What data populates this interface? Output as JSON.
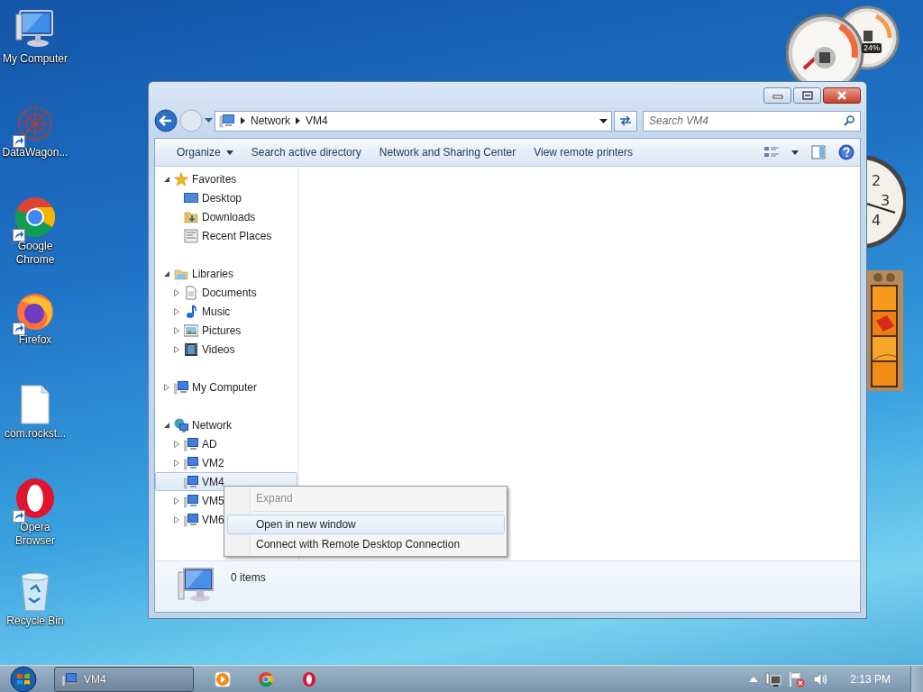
{
  "desktop_icons": [
    {
      "label": "My Computer",
      "kind": "computer",
      "shortcut": false
    },
    {
      "label": "DataWagon...",
      "kind": "art",
      "shortcut": true
    },
    {
      "label": "Google Chrome",
      "kind": "chrome",
      "shortcut": true
    },
    {
      "label": "Firefox",
      "kind": "firefox",
      "shortcut": true
    },
    {
      "label": "com.rockst...",
      "kind": "file",
      "shortcut": false
    },
    {
      "label": "Opera Browser",
      "kind": "opera",
      "shortcut": true
    },
    {
      "label": "Recycle Bin",
      "kind": "recycle",
      "shortcut": false
    }
  ],
  "gadgets": {
    "cpu_meter": {
      "reading": "24%"
    },
    "clock": {
      "numerals": [
        "2",
        "3",
        "4"
      ]
    }
  },
  "window": {
    "address": {
      "crumbs": [
        "Network",
        "VM4"
      ],
      "search_placeholder": "Search VM4"
    },
    "command_bar": [
      {
        "label": "Organize",
        "dropdown": true
      },
      {
        "label": "Search active directory",
        "dropdown": false
      },
      {
        "label": "Network and Sharing Center",
        "dropdown": false
      },
      {
        "label": "View remote printers",
        "dropdown": false
      }
    ],
    "nav_tree": [
      {
        "label": "Favorites",
        "kind": "star",
        "expanded": true,
        "selected": false,
        "children": [
          {
            "label": "Desktop",
            "kind": "desktop",
            "selected": false
          },
          {
            "label": "Downloads",
            "kind": "downloads",
            "selected": false
          },
          {
            "label": "Recent Places",
            "kind": "recent",
            "selected": false
          }
        ]
      },
      {
        "label": "Libraries",
        "kind": "library",
        "expanded": true,
        "selected": false,
        "children": [
          {
            "label": "Documents",
            "kind": "document",
            "expanded": false,
            "selected": false
          },
          {
            "label": "Music",
            "kind": "music",
            "expanded": false,
            "selected": false
          },
          {
            "label": "Pictures",
            "kind": "pictures",
            "expanded": false,
            "selected": false
          },
          {
            "label": "Videos",
            "kind": "videos",
            "expanded": false,
            "selected": false
          }
        ]
      },
      {
        "label": "My Computer",
        "kind": "netpc",
        "expanded": false,
        "selected": false
      },
      {
        "label": "Network",
        "kind": "network",
        "expanded": true,
        "selected": false,
        "children": [
          {
            "label": "AD",
            "kind": "netpc",
            "expanded": false,
            "selected": false
          },
          {
            "label": "VM2",
            "kind": "netpc",
            "expanded": false,
            "selected": false
          },
          {
            "label": "VM4",
            "kind": "netpc",
            "selected": true
          },
          {
            "label": "VM5",
            "kind": "netpc",
            "expanded": false,
            "selected": false
          },
          {
            "label": "VM6",
            "kind": "netpc",
            "expanded": false,
            "selected": false
          }
        ]
      }
    ],
    "details": {
      "text": "0 items"
    }
  },
  "context_menu": [
    {
      "label": "Expand",
      "disabled": true,
      "selected": false
    },
    {
      "label": "Open in new window",
      "disabled": false,
      "selected": true
    },
    {
      "label": "Connect with Remote Desktop Connection",
      "disabled": false,
      "selected": false
    }
  ],
  "taskbar": {
    "tasks": [
      {
        "label": "VM4"
      }
    ],
    "pinned": [
      {
        "kind": "media"
      },
      {
        "kind": "chrome"
      },
      {
        "kind": "opera"
      }
    ],
    "clock": "2:13 PM"
  }
}
